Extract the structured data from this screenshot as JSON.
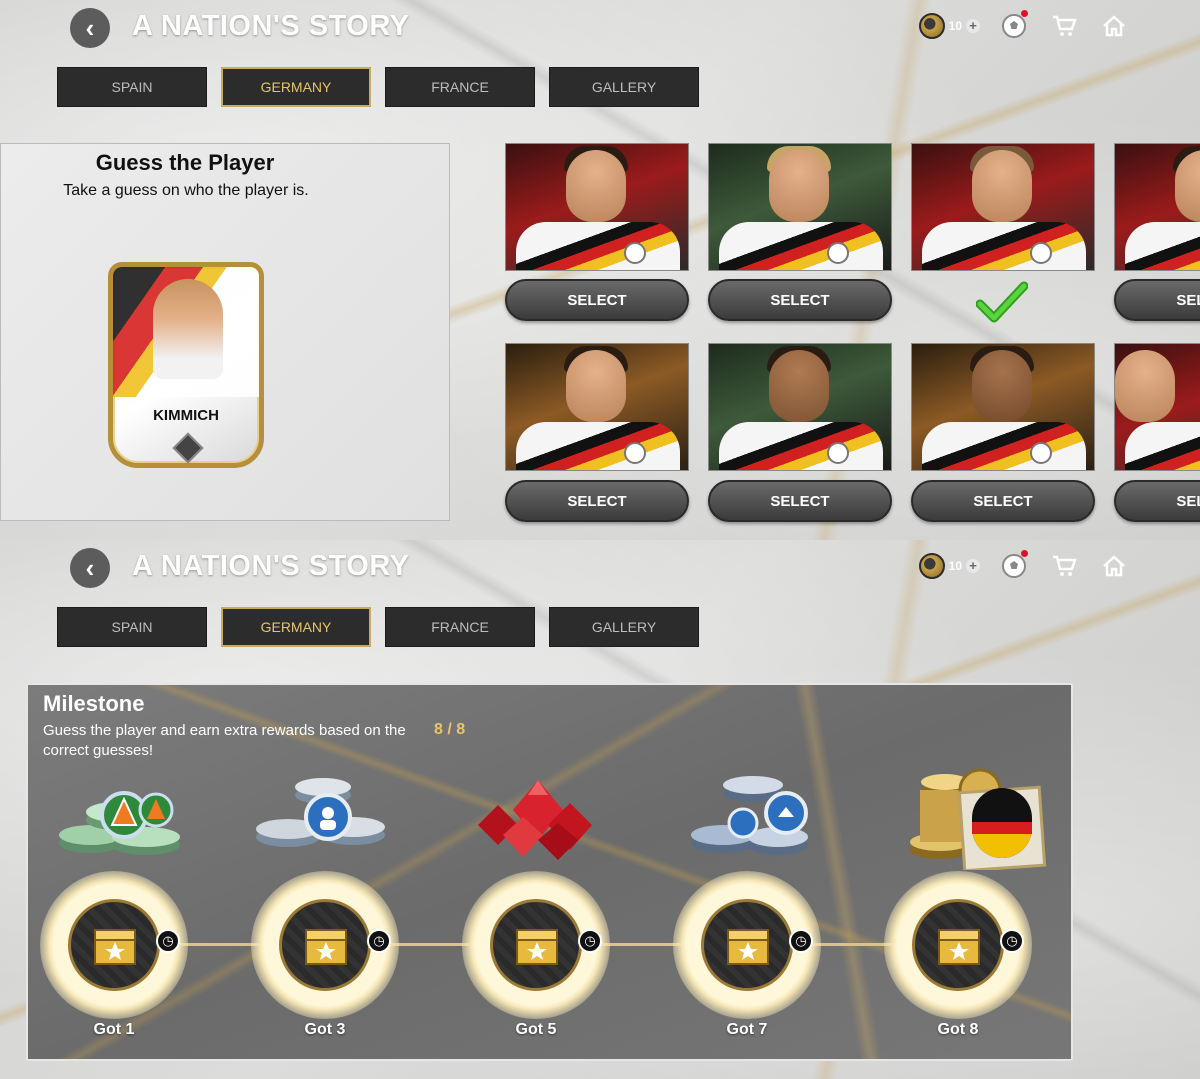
{
  "header": {
    "back_icon": "chevron-left-icon",
    "title": "A NATION'S STORY",
    "coin_count": "10",
    "icons": [
      "coin-icon",
      "plus-icon",
      "football-icon",
      "cart-icon",
      "home-icon"
    ]
  },
  "tabs": [
    {
      "label": "SPAIN",
      "active": false
    },
    {
      "label": "GERMANY",
      "active": true
    },
    {
      "label": "FRANCE",
      "active": false
    },
    {
      "label": "GALLERY",
      "active": false
    }
  ],
  "guess": {
    "title": "Guess the Player",
    "subtitle": "Take a guess on who the player is.",
    "card_name": "KIMMICH"
  },
  "grid": {
    "row1": [
      {
        "button": "SELECT",
        "selected": false
      },
      {
        "button": "SELECT",
        "selected": false
      },
      {
        "button": "",
        "selected": true
      },
      {
        "button": "SELECT",
        "selected": false
      }
    ],
    "row2": [
      {
        "button": "SELECT",
        "selected": false
      },
      {
        "button": "SELECT",
        "selected": false
      },
      {
        "button": "SELECT",
        "selected": false
      },
      {
        "button": "SELECT",
        "selected": false
      }
    ]
  },
  "milestone": {
    "title": "Milestone",
    "description": "Guess the player and earn extra rewards based on the correct guesses!",
    "progress": "8 / 8",
    "nodes": [
      {
        "label": "Got 1",
        "reward": "green-tokens-icon"
      },
      {
        "label": "Got 3",
        "reward": "blue-silver-tokens-icon"
      },
      {
        "label": "Got 5",
        "reward": "red-gems-icon"
      },
      {
        "label": "Got 7",
        "reward": "blue-tokens-icon"
      },
      {
        "label": "Got 8",
        "reward": "gold-tokens-germany-badge-icon"
      }
    ]
  },
  "colors": {
    "accent_gold": "#c9a95a",
    "tab_bg": "#2c2c2c",
    "check_green": "#3fbf2a"
  }
}
